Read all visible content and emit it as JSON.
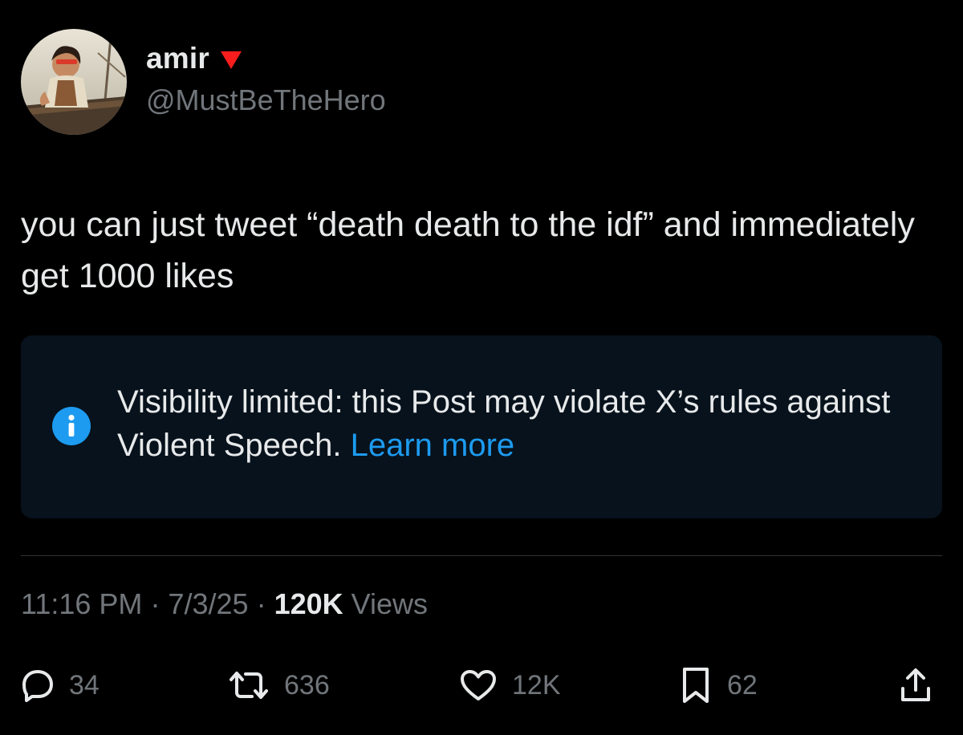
{
  "author": {
    "display_name": "amir",
    "handle": "@MustBeTheHero",
    "badge_icon": "red-triangle-icon",
    "badge_color": "#f91d1d"
  },
  "tweet": {
    "text": "you can just tweet “death death to the idf” and immediately get 1000 likes"
  },
  "notice": {
    "icon": "info-icon",
    "message": "Visibility limited: this Post may violate X’s rules against Violent Speech.",
    "link_label": "Learn more",
    "link_color": "#1d9bf0"
  },
  "meta": {
    "time": "11:16 PM",
    "date": "7/3/25",
    "views_count": "120K",
    "views_label": "Views",
    "separator": "·"
  },
  "actions": {
    "replies": "34",
    "reposts": "636",
    "likes": "12K",
    "bookmarks": "62"
  },
  "colors": {
    "background": "#000000",
    "text": "#e7e9ea",
    "muted": "#71767b",
    "accent": "#1d9bf0",
    "notice_bg": "#07121c"
  }
}
